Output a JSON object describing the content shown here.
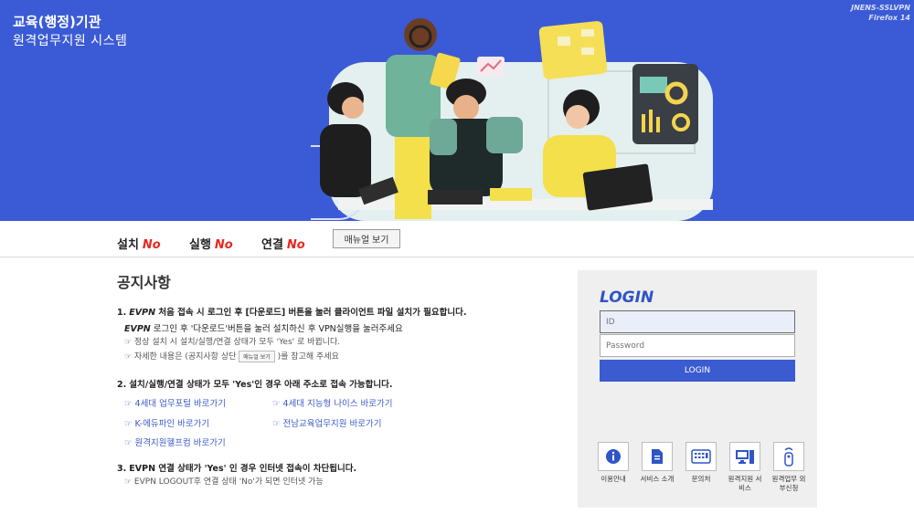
{
  "banner": {
    "title": "교육(행정)기관",
    "subtitle": "원격업무지원 시스템",
    "client_name": "JNENS-SSLVPN",
    "client_browser": "Firefox 14",
    "bg_color": "#3b5bd6"
  },
  "status": {
    "install_label": "설치",
    "install_value": "No",
    "run_label": "실행",
    "run_value": "No",
    "connect_label": "연결",
    "connect_value": "No",
    "manual_button": "매뉴얼 보기",
    "value_color": "#e8281f"
  },
  "notice": {
    "title": "공지사항",
    "item1_num": "1.",
    "item1_prefix": "EVPN",
    "item1_text": " 처음 접속 시 로그인 후 [다운로드] 버튼을 눌러 클라이언트 파일 설치가 필요합니다.",
    "item1_sub1_prefix": "EVPN",
    "item1_sub1_text": " 로그인 후 '다운로드'버튼을 눌러 설치하신 후 VPN실행을 눌러주세요",
    "item1_sub2": "☞ 정상 설치 시 설치/실행/연결 상태가 모두 'Yes' 로 바뀝니다.",
    "item1_sub3_a": "☞ 자세한 내용은 (공지사항 상단",
    "item1_sub3_btn": "매뉴얼 보기",
    "item1_sub3_b": ")를 참고해 주세요",
    "item2_num": "2.",
    "item2_text": "설치/실행/연결 상태가 모두 'Yes'인 경우 아래 주소로 접속 가능합니다.",
    "links": [
      "☞ 4세대 업무포털 바로가기",
      "☞ 4세대 지능형 나이스 바로가기",
      "☞ K-에듀파인 바로가기",
      "☞ 전남교육업무지원 바로가기",
      "☞ 원격지원헬프컴 바로가기"
    ],
    "item3_num": "3.",
    "item3_text": "EVPN 연결 상태가 'Yes' 인 경우 인터넷 접속이 차단됩니다.",
    "item3_sub": "☞ EVPN LOGOUT후 연결 상태 'No'가 되면 인터넷 가능"
  },
  "login": {
    "title": "LOGIN",
    "id_placeholder": "ID",
    "pw_placeholder": "Password",
    "button": "LOGIN",
    "accent": "#3b5bd1"
  },
  "services": [
    {
      "icon": "info-icon",
      "label": "이용안내"
    },
    {
      "icon": "document-icon",
      "label": "서비스 소개"
    },
    {
      "icon": "phone-keypad-icon",
      "label": "문의처"
    },
    {
      "icon": "computer-icon",
      "label": "원격지원 서비스"
    },
    {
      "icon": "remote-icon",
      "label": "원격업무 외부신청"
    }
  ]
}
